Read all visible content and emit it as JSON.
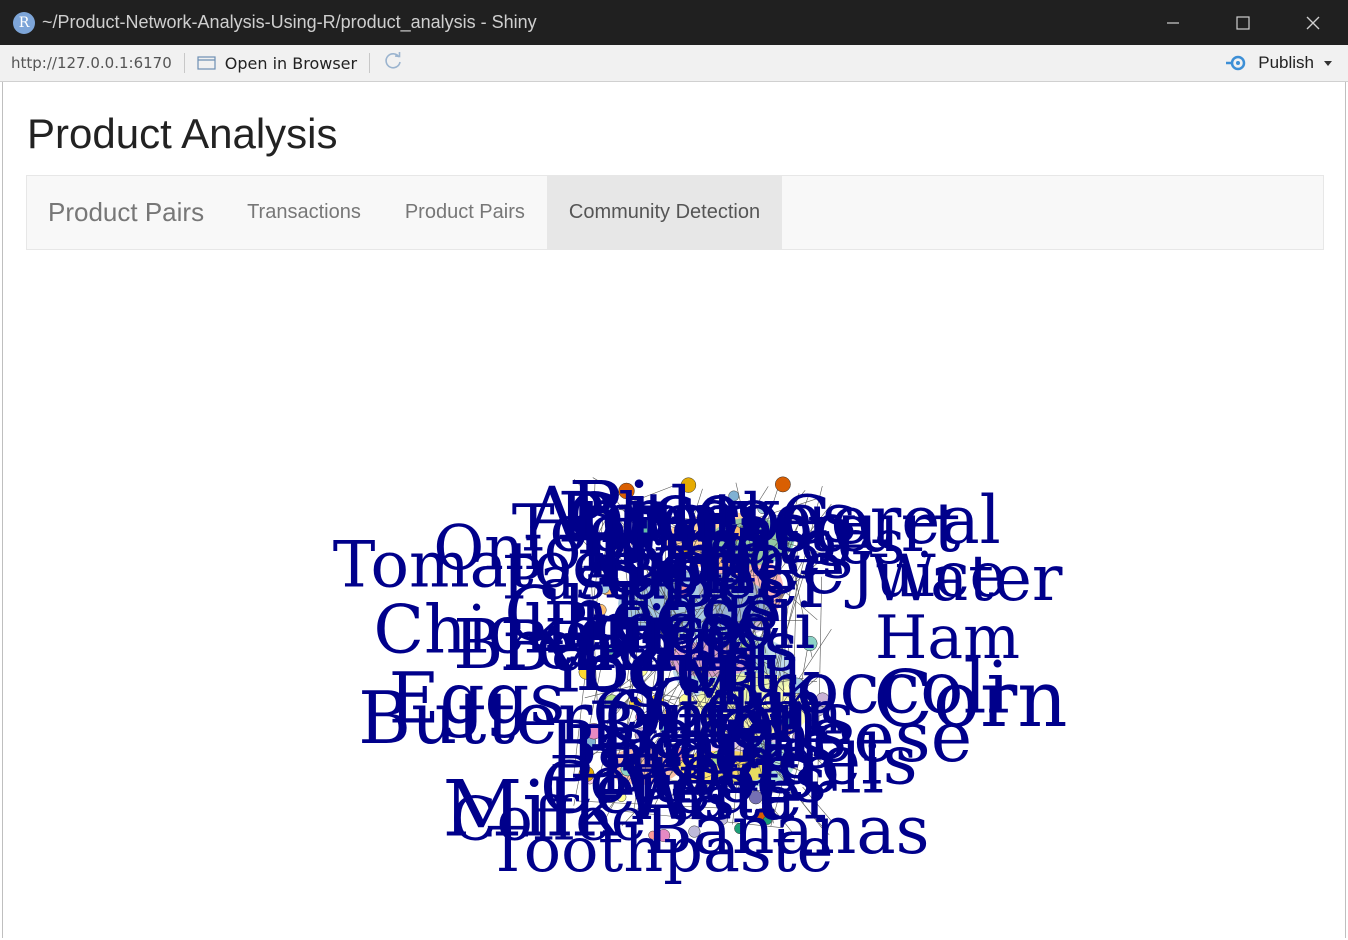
{
  "window": {
    "title": "~/Product-Network-Analysis-Using-R/product_analysis - Shiny",
    "icon_letter": "R"
  },
  "toolbar": {
    "url": "http://127.0.0.1:6170",
    "open_in_browser": "Open in Browser",
    "publish": "Publish"
  },
  "page": {
    "title": "Product Analysis",
    "brand": "Product Pairs",
    "tabs": [
      {
        "label": "Transactions",
        "active": false
      },
      {
        "label": "Product Pairs",
        "active": false
      },
      {
        "label": "Community Detection",
        "active": true
      }
    ]
  },
  "network_plot": {
    "label_color": "#00008b",
    "labels": [
      "Corn",
      "Broccoli",
      "Cheese",
      "Bagels",
      "Bananas",
      "Potatoes",
      "Toothpaste",
      "Coffee",
      "Milk",
      "Butter",
      "Eggs",
      "Bread",
      "Chicken",
      "Tomatoes",
      "Onions",
      "Pasta",
      "Rice",
      "Apples",
      "Beef",
      "Yogurt",
      "Cereal",
      "Water",
      "Juice",
      "Ham"
    ],
    "node_colors": [
      "#f4a582",
      "#b2df8a",
      "#a6cee3",
      "#fb9a99",
      "#fdbf6f",
      "#cab2d6",
      "#ffff99",
      "#8dd3c7",
      "#bebada",
      "#80b1d3",
      "#fccde5",
      "#e78ac3",
      "#66c2a5",
      "#ffd92f",
      "#e6ab02",
      "#1b9e77",
      "#d95f02",
      "#7570b3"
    ]
  },
  "icons": [
    "r-app-icon",
    "minimize-icon",
    "maximize-icon",
    "close-icon",
    "open-in-browser-icon",
    "refresh-icon",
    "publish-icon",
    "dropdown-caret-icon"
  ]
}
